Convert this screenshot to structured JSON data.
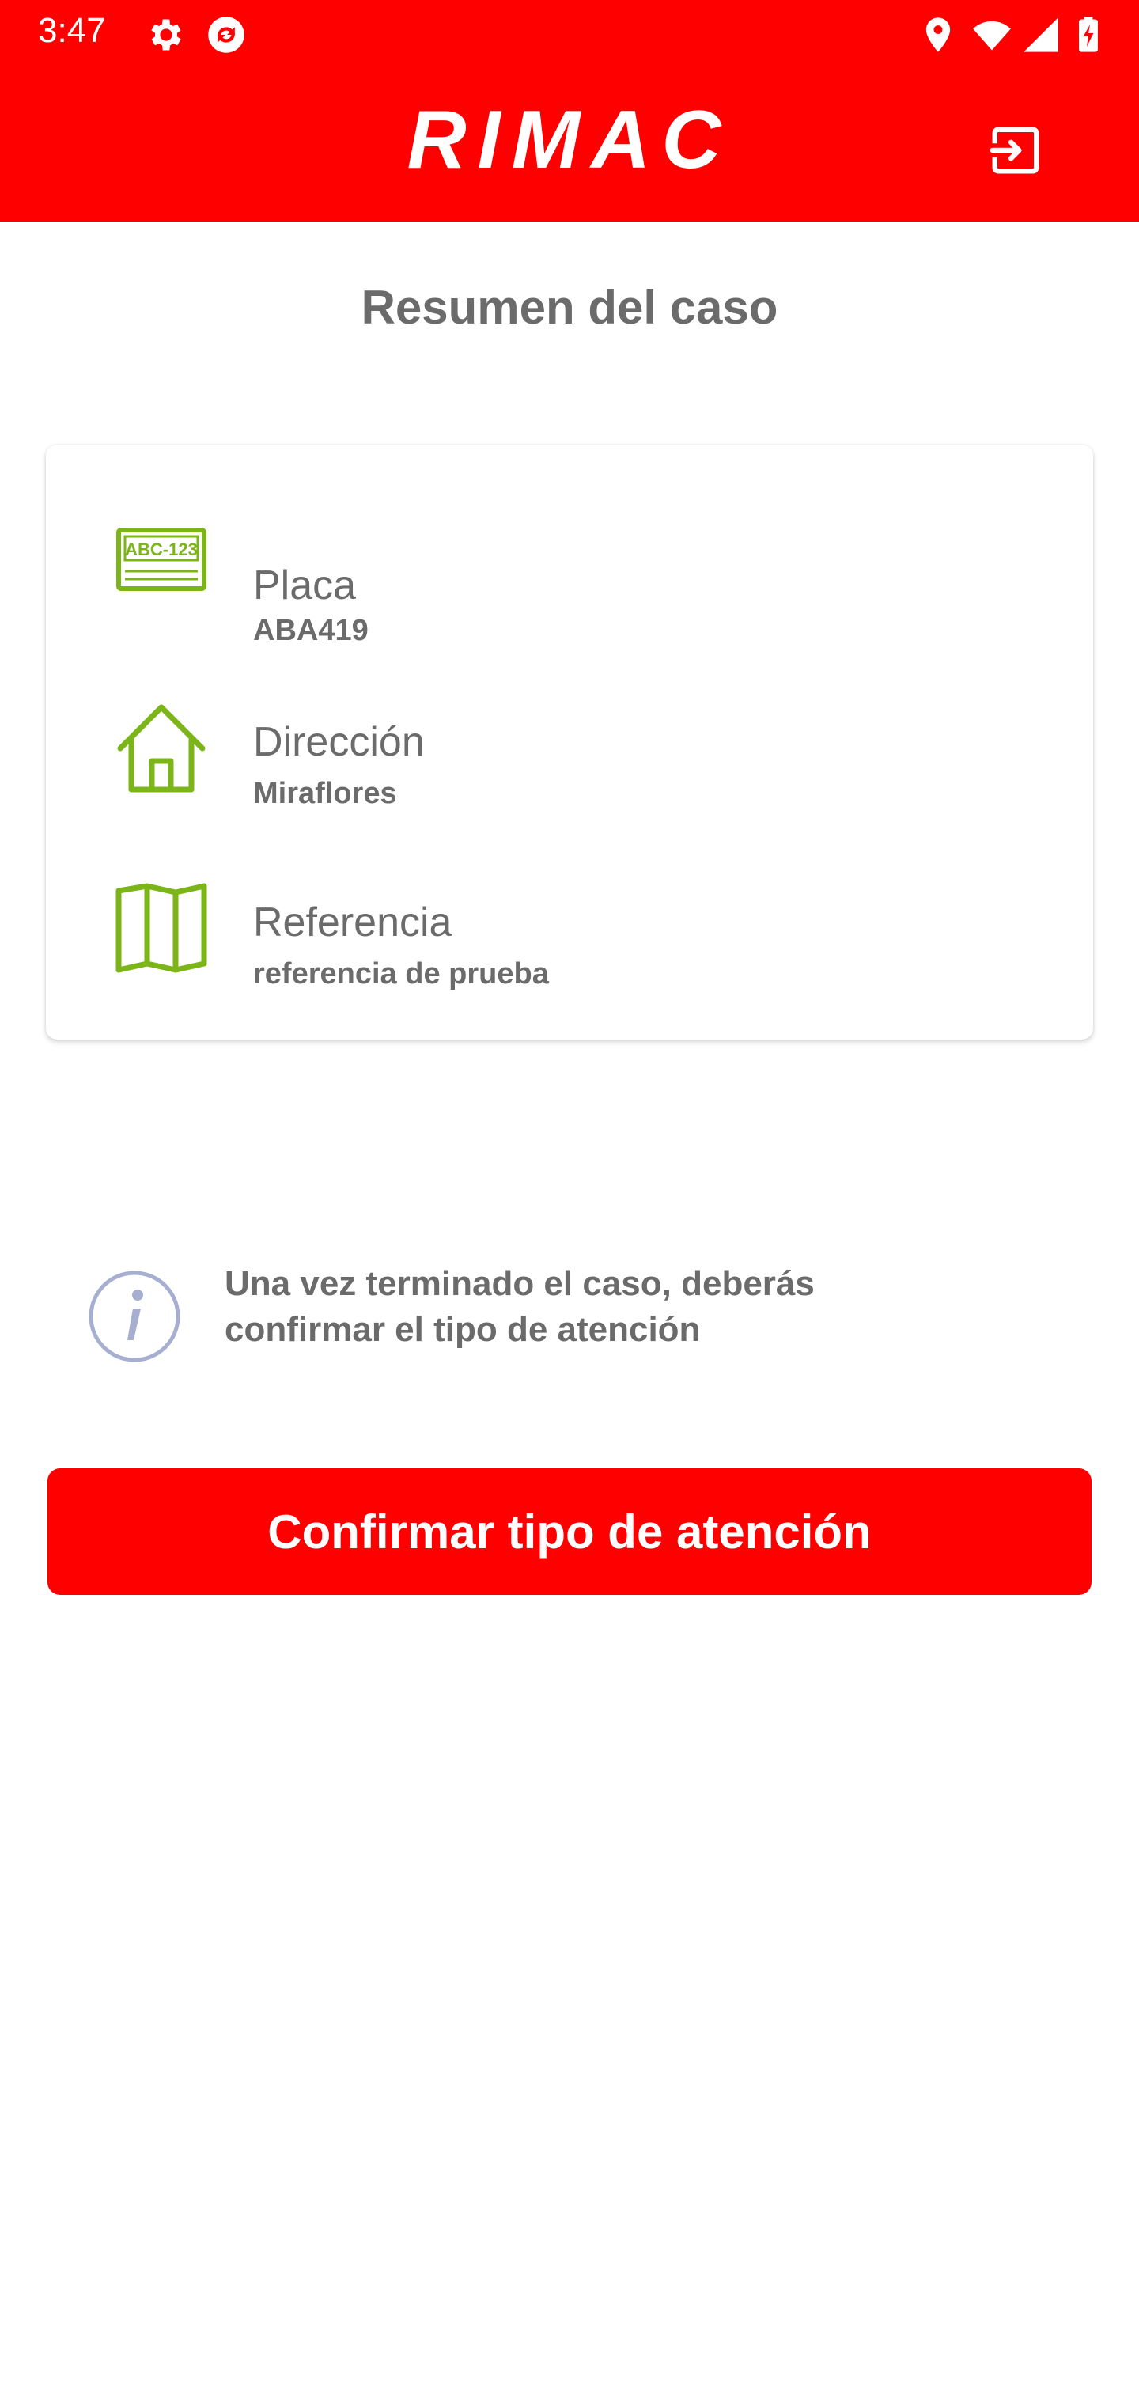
{
  "status_bar": {
    "time": "3:47",
    "left_icons": [
      "gear-icon",
      "sync-app-icon"
    ],
    "right_icons": [
      "location-icon",
      "wifi-icon",
      "signal-icon",
      "battery-charging-icon"
    ]
  },
  "app_bar": {
    "logo_text": "RIMAC",
    "exit_icon": "logout-icon",
    "background_color": "#ff0000"
  },
  "page": {
    "title": "Resumen del caso"
  },
  "summary": {
    "items": [
      {
        "icon": "license-plate-icon",
        "label": "Placa",
        "value": "ABA419",
        "plate_text": "ABC-123"
      },
      {
        "icon": "house-icon",
        "label": "Dirección",
        "value": "Miraflores"
      },
      {
        "icon": "map-icon",
        "label": "Referencia",
        "value": "referencia de prueba"
      }
    ],
    "icon_color": "#7cb518"
  },
  "info": {
    "icon": "info-icon",
    "text_line1": "Una vez terminado el caso, deberás",
    "text_line2": "confirmar el tipo de atención"
  },
  "cta": {
    "label": "Confirmar tipo de atención",
    "color": "#ff0000"
  }
}
